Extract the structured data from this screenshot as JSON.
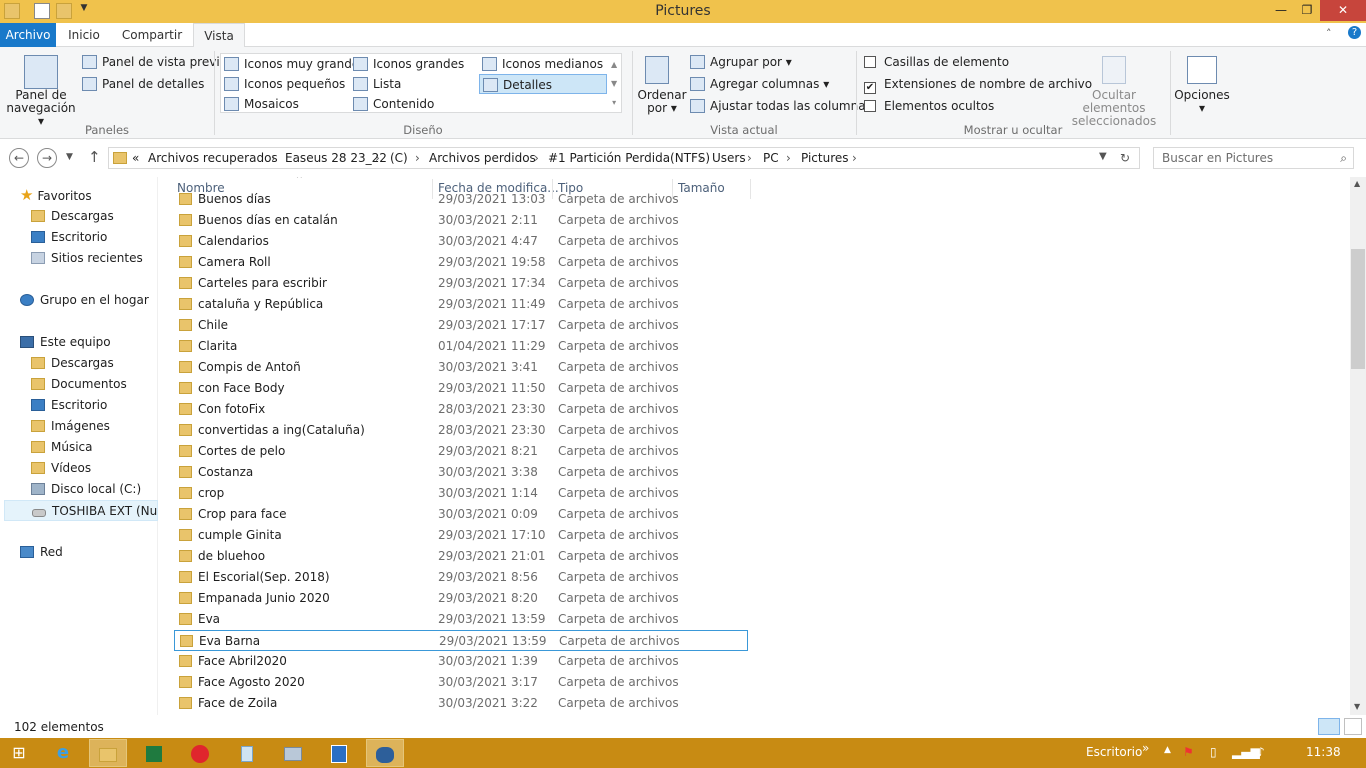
{
  "window": {
    "title": "Pictures"
  },
  "window_buttons": {
    "minimize": "—",
    "maximize": "❐",
    "close": "✕"
  },
  "tabs": [
    {
      "label": "Archivo"
    },
    {
      "label": "Inicio"
    },
    {
      "label": "Compartir"
    },
    {
      "label": "Vista"
    }
  ],
  "ribbon": {
    "panes": {
      "nav_pane": "Panel de navegación",
      "preview": "Panel de vista previa",
      "details": "Panel de detalles",
      "group": "Paneles"
    },
    "layout": {
      "items": [
        "Iconos muy grandes",
        "Iconos grandes",
        "Iconos medianos",
        "Iconos pequeños",
        "Lista",
        "Detalles",
        "Mosaicos",
        "Contenido"
      ],
      "selected": "Detalles",
      "group": "Diseño"
    },
    "current_view": {
      "sort": "Ordenar por",
      "group_by": "Agrupar por",
      "add_columns": "Agregar columnas",
      "fit_columns": "Ajustar todas las columnas",
      "group": "Vista actual"
    },
    "show_hide": {
      "checkboxes": "Casillas de elemento",
      "extensions": "Extensiones de nombre de archivo",
      "hidden": "Elementos ocultos",
      "extensions_checked": true,
      "hide_selected": "Ocultar elementos seleccionados",
      "group": "Mostrar u ocultar"
    },
    "options": "Opciones"
  },
  "address": {
    "crumbs": [
      "Archivos recuperados",
      "Easeus 28 23_22",
      "(C)",
      "Archivos perdidos",
      "#1 Partición Perdida(NTFS)",
      "Users",
      "PC",
      "Pictures"
    ],
    "overflow": "«",
    "search_placeholder": "Buscar en Pictures"
  },
  "nav": {
    "favorites": "Favoritos",
    "fav_items": [
      "Descargas",
      "Escritorio",
      "Sitios recientes"
    ],
    "homegroup": "Grupo en el hogar",
    "this_pc": "Este equipo",
    "pc_items": [
      "Descargas",
      "Documentos",
      "Escritorio",
      "Imágenes",
      "Música",
      "Vídeos",
      "Disco local (C:)",
      "TOSHIBA EXT (Nuer"
    ],
    "network": "Red"
  },
  "columns": {
    "name": "Nombre",
    "date": "Fecha de modifica...",
    "type": "Tipo",
    "size": "Tamaño"
  },
  "files": [
    {
      "name": "Buenos días",
      "date": "29/03/2021 13:03",
      "type": "Carpeta de archivos"
    },
    {
      "name": "Buenos días en catalán",
      "date": "30/03/2021 2:11",
      "type": "Carpeta de archivos"
    },
    {
      "name": "Calendarios",
      "date": "30/03/2021 4:47",
      "type": "Carpeta de archivos"
    },
    {
      "name": "Camera Roll",
      "date": "29/03/2021 19:58",
      "type": "Carpeta de archivos"
    },
    {
      "name": "Carteles para escribir",
      "date": "29/03/2021 17:34",
      "type": "Carpeta de archivos"
    },
    {
      "name": "cataluña y República",
      "date": "29/03/2021 11:49",
      "type": "Carpeta de archivos"
    },
    {
      "name": "Chile",
      "date": "29/03/2021 17:17",
      "type": "Carpeta de archivos"
    },
    {
      "name": "Clarita",
      "date": "01/04/2021 11:29",
      "type": "Carpeta de archivos"
    },
    {
      "name": "Compis de Antoñ",
      "date": "30/03/2021 3:41",
      "type": "Carpeta de archivos"
    },
    {
      "name": "con Face Body",
      "date": "29/03/2021 11:50",
      "type": "Carpeta de archivos"
    },
    {
      "name": "Con fotoFix",
      "date": "28/03/2021 23:30",
      "type": "Carpeta de archivos"
    },
    {
      "name": "convertidas a ing(Cataluña)",
      "date": "28/03/2021 23:30",
      "type": "Carpeta de archivos"
    },
    {
      "name": "Cortes de pelo",
      "date": "29/03/2021 8:21",
      "type": "Carpeta de archivos"
    },
    {
      "name": "Costanza",
      "date": "30/03/2021 3:38",
      "type": "Carpeta de archivos"
    },
    {
      "name": "crop",
      "date": "30/03/2021 1:14",
      "type": "Carpeta de archivos"
    },
    {
      "name": "Crop para face",
      "date": "30/03/2021 0:09",
      "type": "Carpeta de archivos"
    },
    {
      "name": "cumple Ginita",
      "date": "29/03/2021 17:10",
      "type": "Carpeta de archivos"
    },
    {
      "name": "de bluehoo",
      "date": "29/03/2021 21:01",
      "type": "Carpeta de archivos"
    },
    {
      "name": "El Escorial(Sep. 2018)",
      "date": "29/03/2021 8:56",
      "type": "Carpeta de archivos"
    },
    {
      "name": "Empanada Junio 2020",
      "date": "29/03/2021 8:20",
      "type": "Carpeta de archivos"
    },
    {
      "name": "Eva",
      "date": "29/03/2021 13:59",
      "type": "Carpeta de archivos"
    },
    {
      "name": "Eva Barna",
      "date": "29/03/2021 13:59",
      "type": "Carpeta de archivos"
    },
    {
      "name": "Face Abril2020",
      "date": "30/03/2021 1:39",
      "type": "Carpeta de archivos"
    },
    {
      "name": "Face Agosto 2020",
      "date": "30/03/2021 3:17",
      "type": "Carpeta de archivos"
    },
    {
      "name": "Face de Zoila",
      "date": "30/03/2021 3:22",
      "type": "Carpeta de archivos"
    }
  ],
  "selected_file": "Eva Barna",
  "status": {
    "count": "102 elementos"
  },
  "taskbar": {
    "desktop": "Escritorio",
    "time": "11:38"
  }
}
